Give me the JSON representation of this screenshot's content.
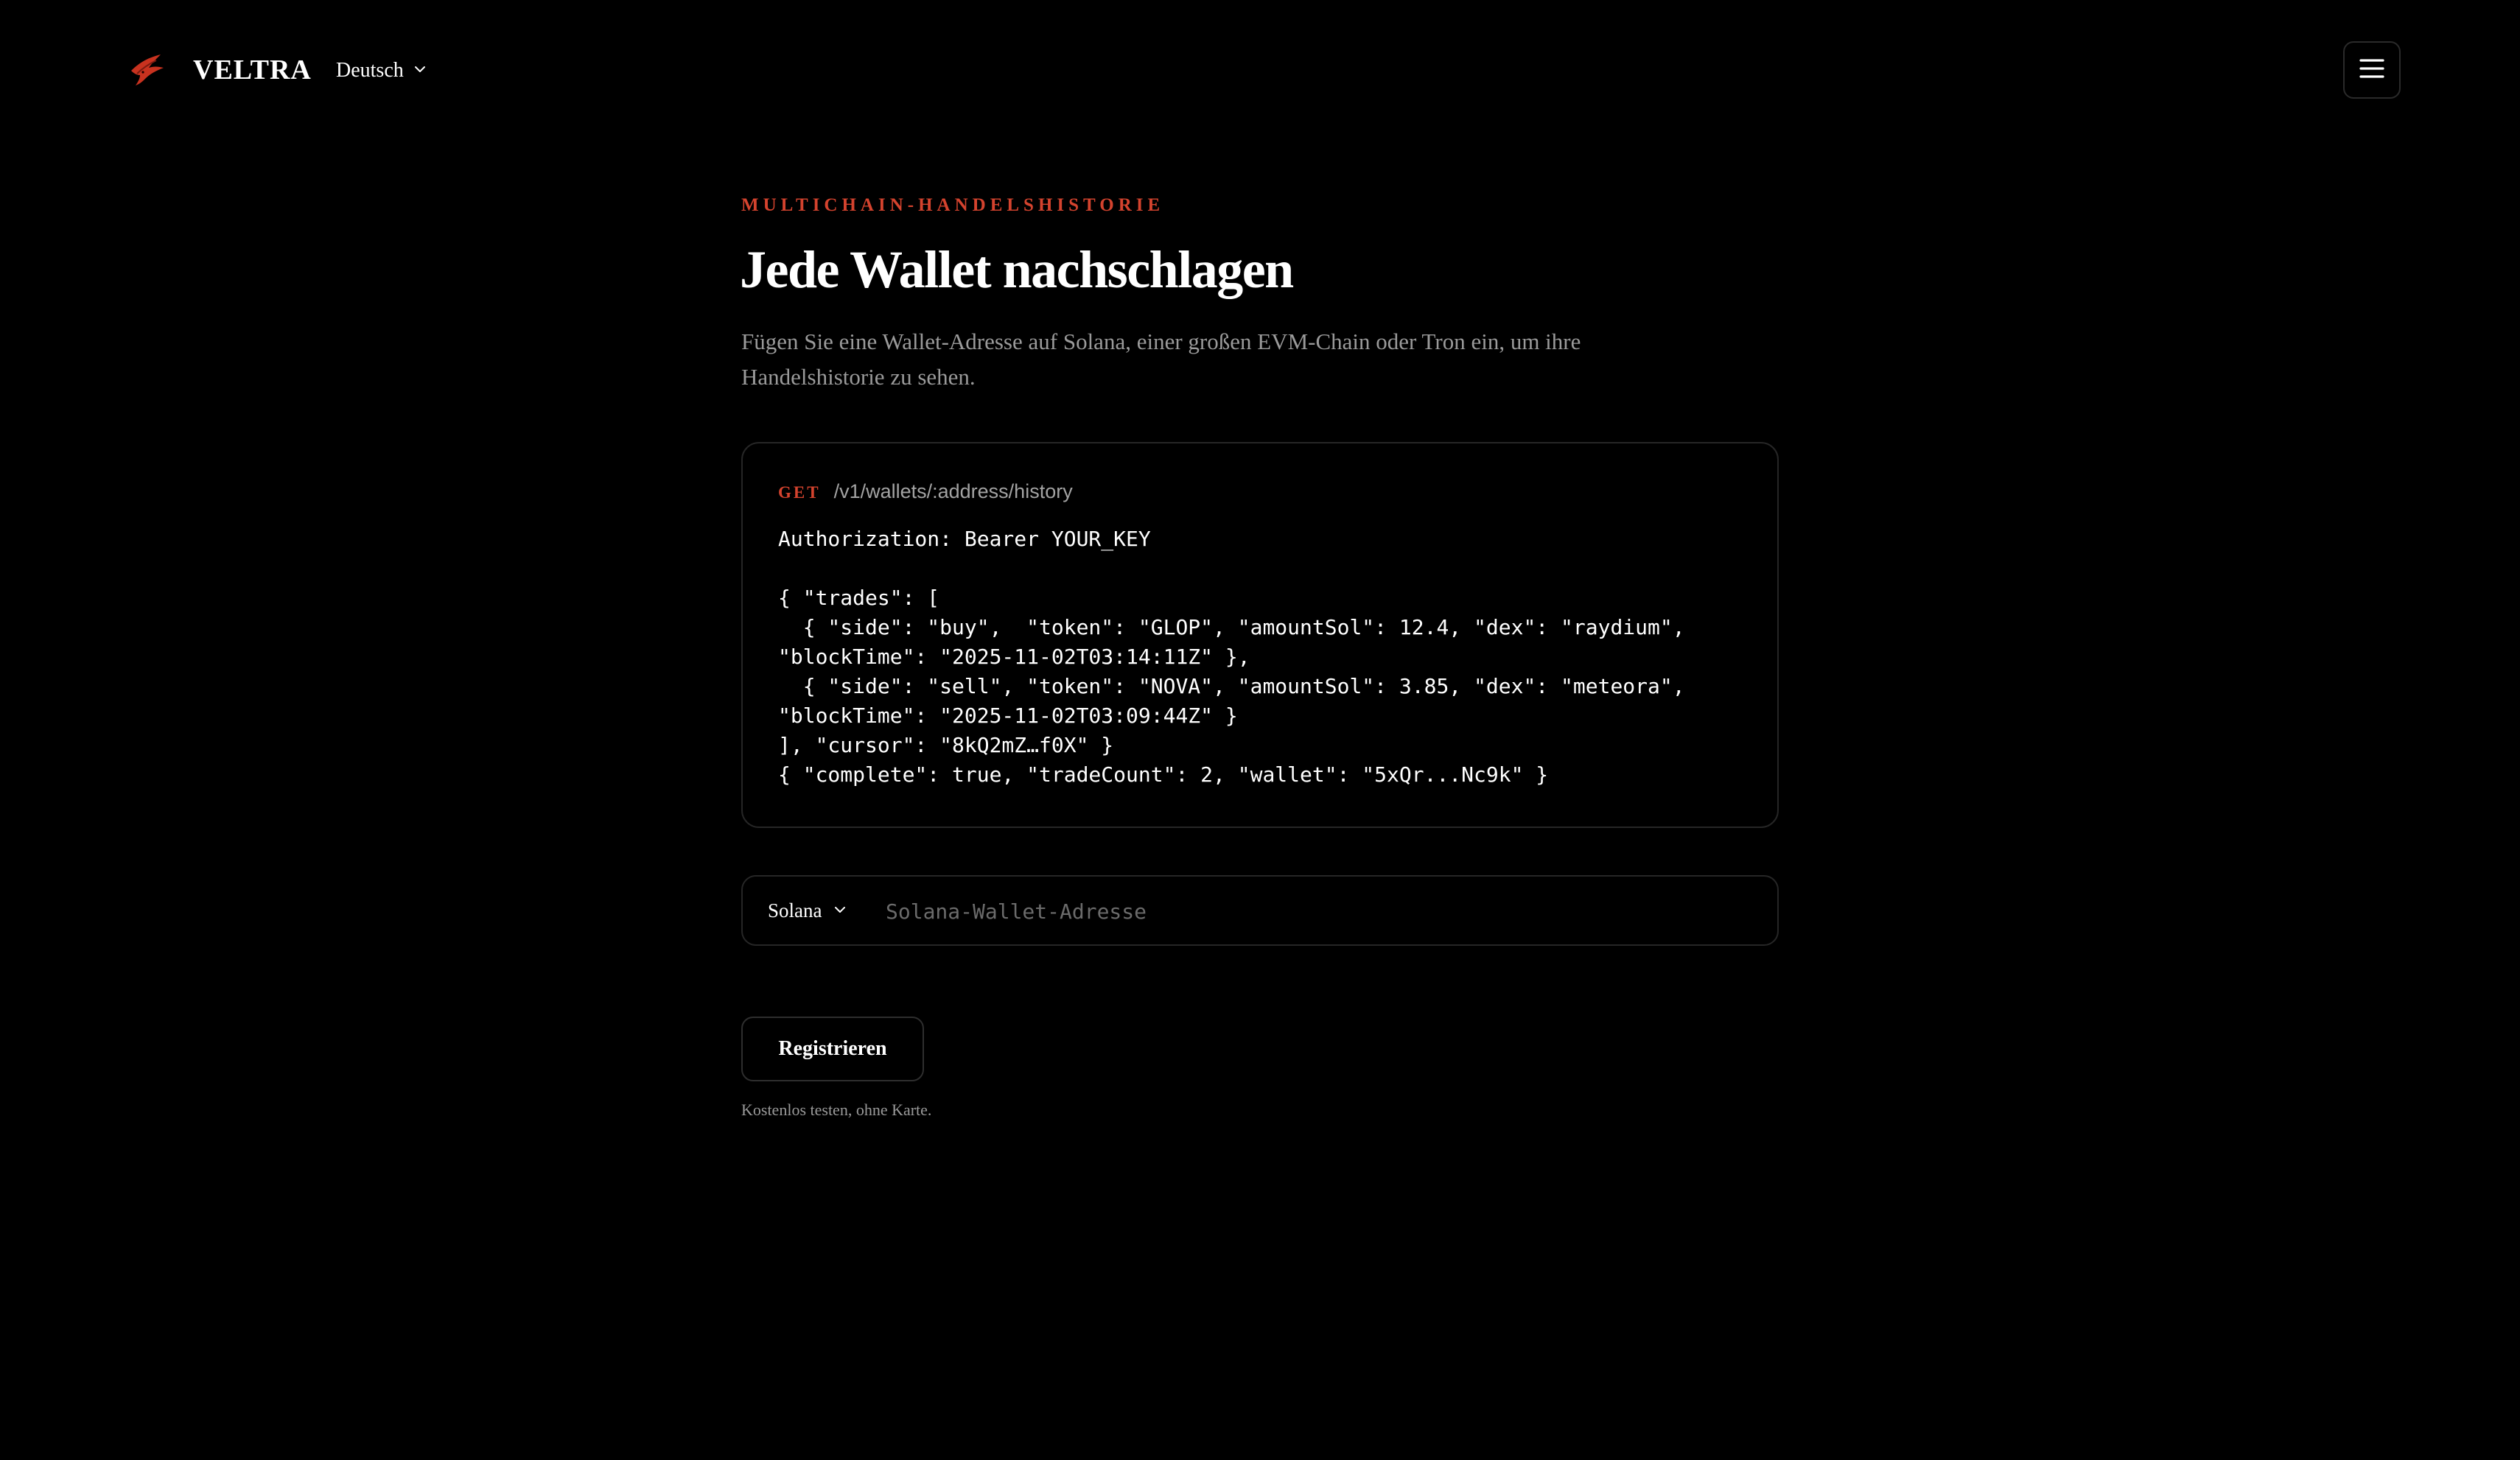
{
  "header": {
    "logo_icon": "bird-logo-icon",
    "brand": "VELTRA",
    "language": "Deutsch",
    "menu_icon": "hamburger-menu-icon"
  },
  "hero": {
    "eyebrow": "MULTICHAIN-HANDELSHISTORIE",
    "title": "Jede Wallet nachschlagen",
    "subtitle": "Fügen Sie eine Wallet-Adresse auf Solana, einer großen EVM-Chain oder Tron ein, um ihre Handelshistorie zu sehen."
  },
  "api_example": {
    "method": "GET",
    "path": "/v1/wallets/:address/history",
    "code": "Authorization: Bearer YOUR_KEY\n\n{ \"trades\": [\n  { \"side\": \"buy\",  \"token\": \"GLOP\", \"amountSol\": 12.4, \"dex\": \"raydium\",\n\"blockTime\": \"2025-11-02T03:14:11Z\" },\n  { \"side\": \"sell\", \"token\": \"NOVA\", \"amountSol\": 3.85, \"dex\": \"meteora\",\n\"blockTime\": \"2025-11-02T03:09:44Z\" }\n], \"cursor\": \"8kQ2mZ…f0X\" }\n{ \"complete\": true, \"tradeCount\": 2, \"wallet\": \"5xQr...Nc9k\" }"
  },
  "search": {
    "chain": "Solana",
    "address_value": "",
    "address_placeholder": "Solana-Wallet-Adresse"
  },
  "cta": {
    "register_label": "Registrieren",
    "note": "Kostenlos testen, ohne Karte."
  },
  "colors": {
    "background": "#000000",
    "accent": "#d4432e",
    "muted_text": "#9a9a9a",
    "border": "#262626"
  }
}
